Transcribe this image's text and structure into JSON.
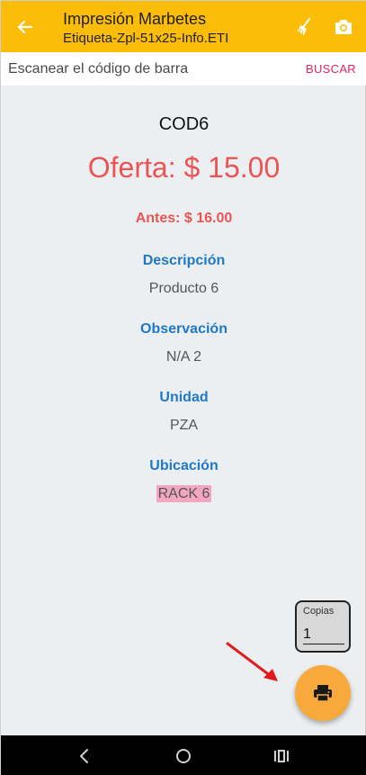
{
  "header": {
    "title": "Impresión Marbetes",
    "subtitle": "Etiqueta-Zpl-51x25-Info.ETI",
    "back_icon": "arrow-left-icon",
    "clear_icon": "broom-icon",
    "camera_icon": "camera-icon"
  },
  "search": {
    "placeholder": "Escanear el código de barra",
    "button_label": "BUSCAR"
  },
  "product": {
    "code": "COD6",
    "offer": "Oferta: $ 15.00",
    "before": "Antes: $ 16.00",
    "fields": [
      {
        "label": "Descripción",
        "value": "Producto 6"
      },
      {
        "label": "Observación",
        "value": "N/A 2"
      },
      {
        "label": "Unidad",
        "value": "PZA"
      },
      {
        "label": "Ubicación",
        "value": "RACK 6"
      }
    ]
  },
  "copies": {
    "label": "Copias",
    "value": "1"
  },
  "fab": {
    "icon": "printer-icon"
  },
  "nav": {
    "back_icon": "nav-back-icon",
    "home_icon": "nav-home-icon",
    "recents_icon": "nav-recents-icon"
  },
  "colors": {
    "appbar": "#fbbd08",
    "offer": "#ea5455",
    "label": "#1f78c8",
    "accent_button": "#e0245e",
    "fab": "#f7a93b",
    "highlight": "#f3a6c0"
  }
}
